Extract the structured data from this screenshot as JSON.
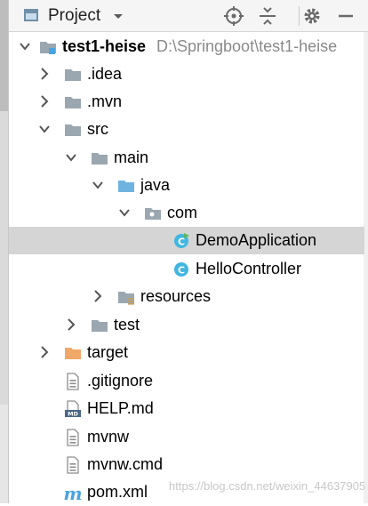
{
  "toolbar": {
    "title": "Project"
  },
  "tree": {
    "rows": [
      {
        "label": "test1-heise",
        "path": "D:\\Springboot\\test1-heise"
      },
      {
        "label": ".idea"
      },
      {
        "label": ".mvn"
      },
      {
        "label": "src"
      },
      {
        "label": "main"
      },
      {
        "label": "java"
      },
      {
        "label": "com"
      },
      {
        "label": "DemoApplication"
      },
      {
        "label": "HelloController"
      },
      {
        "label": "resources"
      },
      {
        "label": "test"
      },
      {
        "label": "target"
      },
      {
        "label": ".gitignore"
      },
      {
        "label": "HELP.md"
      },
      {
        "label": "mvnw"
      },
      {
        "label": "mvnw.cmd"
      },
      {
        "label": "pom.xml"
      }
    ]
  },
  "watermark": "https://blog.csdn.net/weixin_44637905",
  "colors": {
    "folder": "#9aa7b0",
    "source_folder": "#6fb3e0",
    "excluded_folder": "#f0a868",
    "java_class": "#40b6e0",
    "selection": "#d5d5d5"
  },
  "icons": {
    "project": "project-folder-icon",
    "folder": "folder-icon",
    "source_folder": "source-folder-icon",
    "package": "package-icon",
    "resources_folder": "resources-folder-icon",
    "excluded_folder": "excluded-folder-icon",
    "java_class": "java-class-icon",
    "spring_class": "spring-boot-class-icon",
    "text_file": "text-file-icon",
    "markdown_file": "markdown-file-icon",
    "maven_file": "maven-file-icon"
  }
}
